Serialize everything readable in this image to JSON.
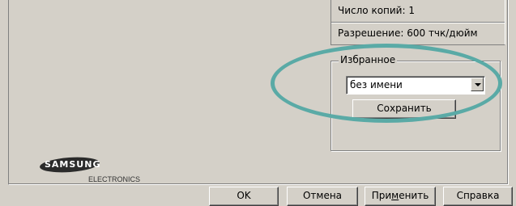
{
  "info": {
    "copies": "Число копий: 1",
    "resolution": "Разрешение: 600 тчк/дюйм"
  },
  "favorites": {
    "legend": "Избранное",
    "selected": "без имени",
    "save_label": "Сохранить"
  },
  "logo": {
    "brand": "SAMSUNG",
    "sub": "ELECTRONICS"
  },
  "footer": {
    "ok": "OK",
    "cancel": "Отмена",
    "apply_pre": "При",
    "apply_mnemonic": "м",
    "apply_post": "енить",
    "help": "Справка"
  },
  "colors": {
    "highlight_ellipse": "#5aaaa6",
    "dialog_face": "#d4d0c8"
  }
}
